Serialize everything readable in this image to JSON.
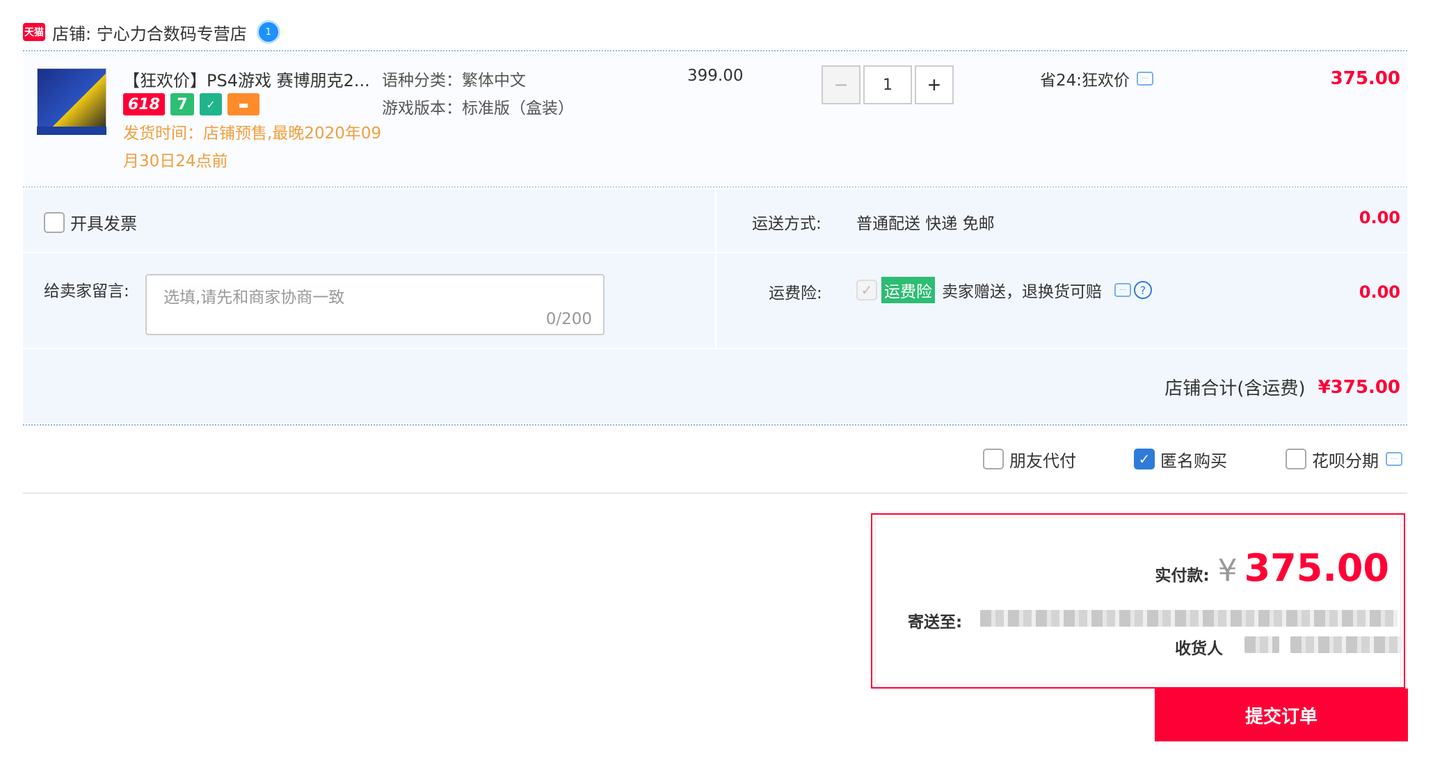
{
  "shop": {
    "logo_text": "天猫",
    "label": "店铺: 宁心力合数码专营店",
    "ww_badge": "1"
  },
  "item": {
    "title": "【狂欢价】PS4游戏 赛博朋克2...",
    "badges": [
      "618",
      "7"
    ],
    "ship_time": "发货时间：店铺预售,最晚2020年09月30日24点前",
    "sku": [
      {
        "text": "语种分类：繁体中文"
      },
      {
        "text": "游戏版本：标准版（盒装）"
      }
    ],
    "price": "399.00",
    "quantity": "1",
    "qty_minus": "−",
    "qty_plus": "+",
    "promo": "省24:狂欢价",
    "total": "375.00"
  },
  "options": {
    "invoice_label": "开具发票",
    "message_label": "给卖家留言:",
    "message_placeholder": "选填,请先和商家协商一致",
    "message_count": "0/200",
    "shipping_label": "运送方式:",
    "shipping_value": "普通配送 快递 免邮",
    "shipping_fee": "0.00",
    "insurance_label": "运费险:",
    "insurance_tag": "运费险",
    "insurance_text": "卖家赠送，退换货可赔",
    "insurance_fee": "0.00",
    "shop_sum_label": "店铺合计(含运费)",
    "shop_sum_value": "¥375.00"
  },
  "pay_options": [
    {
      "label": "朋友代付",
      "checked": false
    },
    {
      "label": "匿名购买",
      "checked": true
    },
    {
      "label": "花呗分期",
      "checked": false
    }
  ],
  "summary": {
    "pay_label": "实付款:",
    "currency": "¥",
    "amount": "375.00",
    "address_label": "寄送至:",
    "receiver_label": "收货人"
  },
  "submit_label": "提交订单",
  "colors": {
    "accent": "#ff0036",
    "link": "#2f7bd9",
    "panel_bg": "#f2f7fe",
    "ship_time": "#f19e3e",
    "insurance_tag": "#2dbd73"
  }
}
